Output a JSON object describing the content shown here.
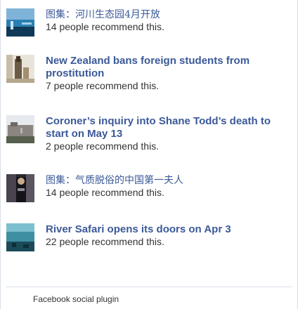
{
  "items": [
    {
      "title": "图集：河川生态园4月开放",
      "count_text": "14 people recommend this."
    },
    {
      "title": "New Zealand bans foreign students from prostitution",
      "count_text": "7 people recommend this."
    },
    {
      "title": "Coroner’s inquiry into Shane Todd’s death to start on May 13",
      "count_text": "2 people recommend this."
    },
    {
      "title": "图集：气质脱俗的中国第一夫人",
      "count_text": "14 people recommend this."
    },
    {
      "title": "River Safari opens its doors on Apr 3",
      "count_text": "22 people recommend this."
    }
  ],
  "footer": {
    "label": "Facebook social plugin"
  },
  "colors": {
    "link": "#3b5998",
    "text": "#333333",
    "border": "#d8dee8"
  }
}
